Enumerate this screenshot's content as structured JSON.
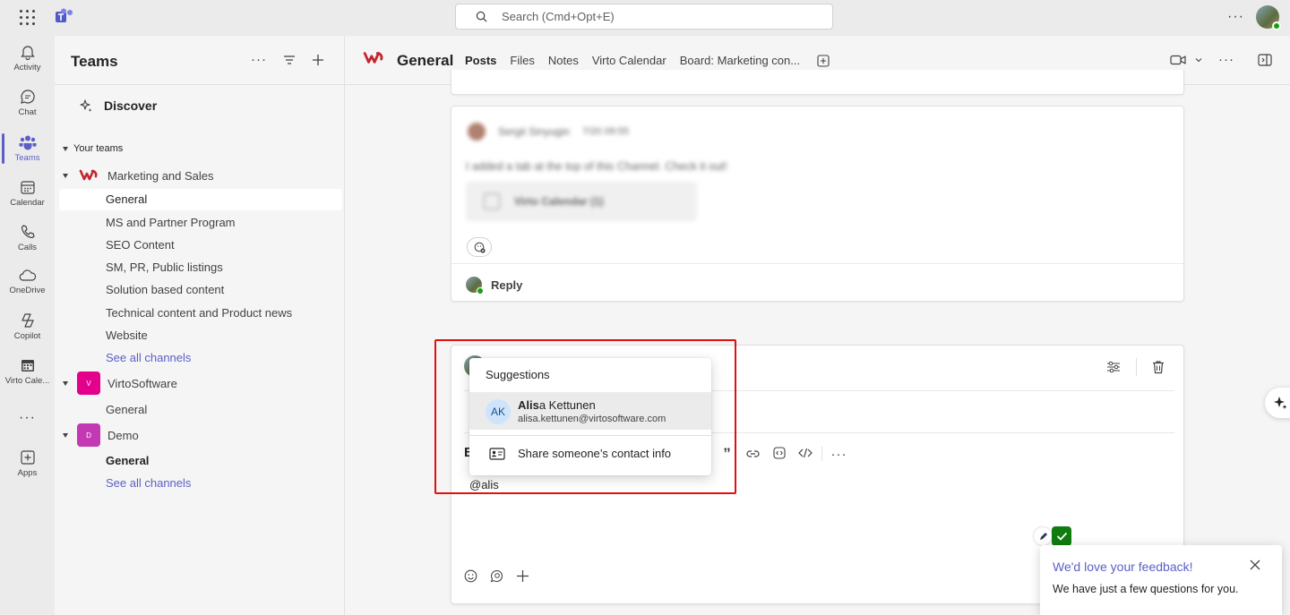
{
  "search": {
    "placeholder": "Search (Cmd+Opt+E)"
  },
  "rail": [
    {
      "label": "Activity"
    },
    {
      "label": "Chat"
    },
    {
      "label": "Teams"
    },
    {
      "label": "Calendar"
    },
    {
      "label": "Calls"
    },
    {
      "label": "OneDrive"
    },
    {
      "label": "Copilot"
    },
    {
      "label": "Virto Cale..."
    },
    {
      "label": "Apps"
    }
  ],
  "panel": {
    "title": "Teams",
    "discover": "Discover",
    "your_teams": "Your teams",
    "teams": [
      {
        "name": "Marketing and Sales",
        "channels": [
          "General",
          "MS and Partner Program",
          "SEO Content",
          "SM, PR, Public listings",
          "Solution based content",
          "Technical content and Product news",
          "Website"
        ],
        "see_all": "See all channels"
      },
      {
        "name": "VirtoSoftware",
        "initial": "V",
        "channels": [
          "General"
        ]
      },
      {
        "name": "Demo",
        "initial": "D",
        "channels": [
          "General"
        ],
        "see_all": "See all channels"
      }
    ]
  },
  "header": {
    "title": "General",
    "tabs": [
      "Posts",
      "Files",
      "Notes",
      "Virto Calendar",
      "Board: Marketing con..."
    ]
  },
  "message": {
    "author": "Sergii Sinyugin",
    "time": "7/20 09:55",
    "text": "I added a tab at the top of this Channel. Check it out!",
    "card_title": "Virto Calendar (1)",
    "reply": "Reply"
  },
  "compose": {
    "text": "@alis",
    "toolbar_bold": "B"
  },
  "popup": {
    "title": "Suggestions",
    "suggestion": {
      "initials": "AK",
      "name_match": "Alis",
      "name_rest": "a Kettunen",
      "email": "alisa.kettunen@virtosoftware.com"
    },
    "share": "Share someone’s contact info"
  },
  "feedback": {
    "title": "We'd love your feedback!",
    "text": "We have just a few questions for you."
  },
  "colors": {
    "accent": "#5b5fc7",
    "highlight": "#e01010",
    "success": "#107c10"
  }
}
